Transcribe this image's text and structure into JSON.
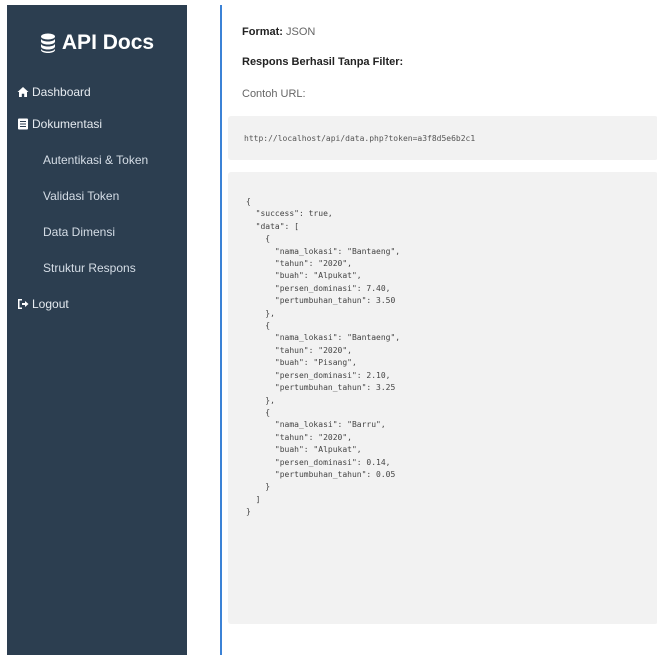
{
  "sidebar": {
    "brand": "API Docs",
    "items": [
      {
        "label": "Dashboard",
        "icon": "home-icon"
      },
      {
        "label": "Dokumentasi",
        "icon": "document-icon"
      }
    ],
    "subitems": [
      "Autentikasi & Token",
      "Validasi Token",
      "Data Dimensi",
      "Struktur Respons"
    ],
    "logout": {
      "label": "Logout",
      "icon": "logout-icon"
    }
  },
  "main": {
    "format_label": "Format:",
    "format_value": "JSON",
    "section_title": "Respons Berhasil Tanpa Filter:",
    "example_label": "Contoh URL:",
    "example_url": "http://localhost/api/data.php?token=a3f8d5e6b2c1",
    "json_example": "{\n  \"success\": true,\n  \"data\": [\n    {\n      \"nama_lokasi\": \"Bantaeng\",\n      \"tahun\": \"2020\",\n      \"buah\": \"Alpukat\",\n      \"persen_dominasi\": 7.40,\n      \"pertumbuhan_tahun\": 3.50\n    },\n    {\n      \"nama_lokasi\": \"Bantaeng\",\n      \"tahun\": \"2020\",\n      \"buah\": \"Pisang\",\n      \"persen_dominasi\": 2.10,\n      \"pertumbuhan_tahun\": 3.25\n    },\n    {\n      \"nama_lokasi\": \"Barru\",\n      \"tahun\": \"2020\",\n      \"buah\": \"Alpukat\",\n      \"persen_dominasi\": 0.14,\n      \"pertumbuhan_tahun\": 0.05\n    }\n  ]\n}"
  },
  "colors": {
    "sidebar_bg": "#2c3e50",
    "accent_line": "#3b82d6",
    "code_bg": "#f2f2f2"
  }
}
